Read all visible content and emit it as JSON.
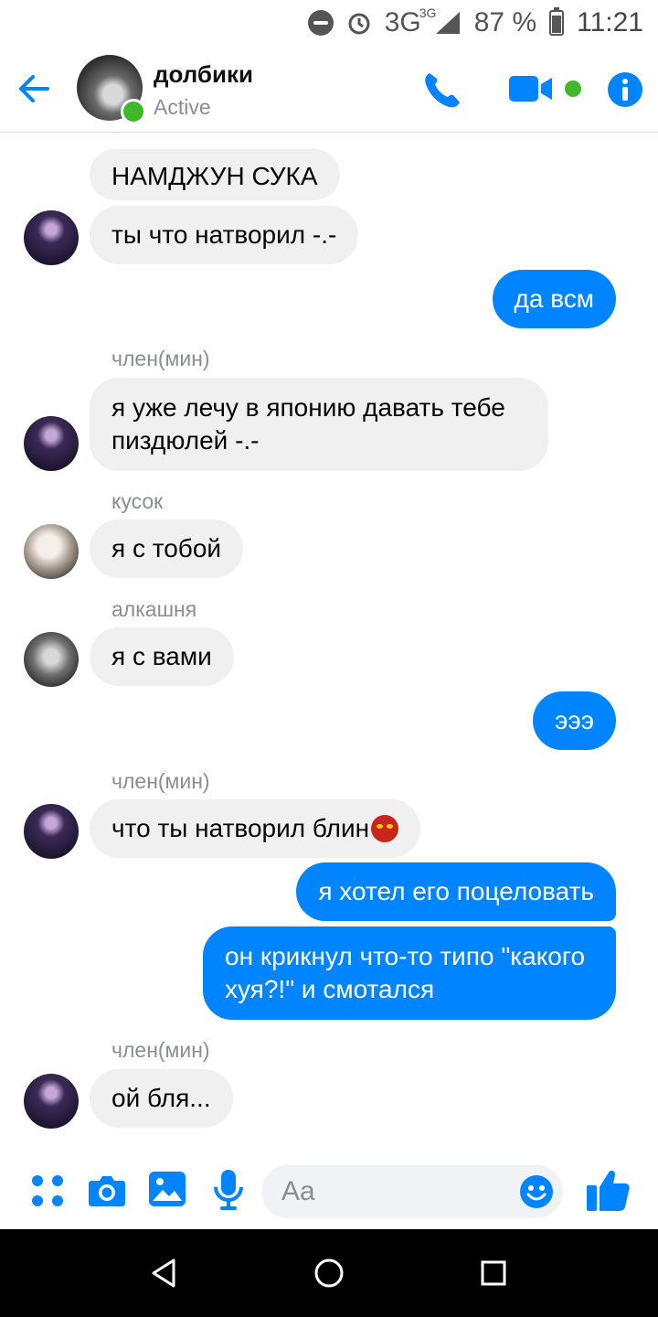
{
  "status_bar": {
    "network": "3G",
    "network_sup": "3G",
    "battery": "87 %",
    "time": "11:21"
  },
  "header": {
    "title": "долбики",
    "status": "Active"
  },
  "messages": [
    {
      "text": "НАМДЖУН СУКА"
    },
    {
      "text": "ты что натворил -.-"
    },
    {
      "text": "да всм"
    },
    {
      "sender": "член(мин)",
      "text": "я уже лечу в японию давать тебе пиздюлей -.-"
    },
    {
      "sender": "кусок",
      "text": "я с тобой"
    },
    {
      "sender": "алкашня",
      "text": "я с вами"
    },
    {
      "text": "эээ"
    },
    {
      "sender": "член(мин)",
      "text": "что ты натворил блин",
      "emoji": "devil-face-icon"
    },
    {
      "text": "я хотел его поцеловать"
    },
    {
      "text": "он крикнул что-то типо \"какого хуя?!\" и смотался"
    },
    {
      "sender": "член(мин)",
      "text": "ой бля..."
    }
  ],
  "composer": {
    "placeholder": "Aa"
  },
  "colors": {
    "accent": "#0084ff",
    "incoming_bubble": "#f0f0f0",
    "online": "#42b72a"
  }
}
